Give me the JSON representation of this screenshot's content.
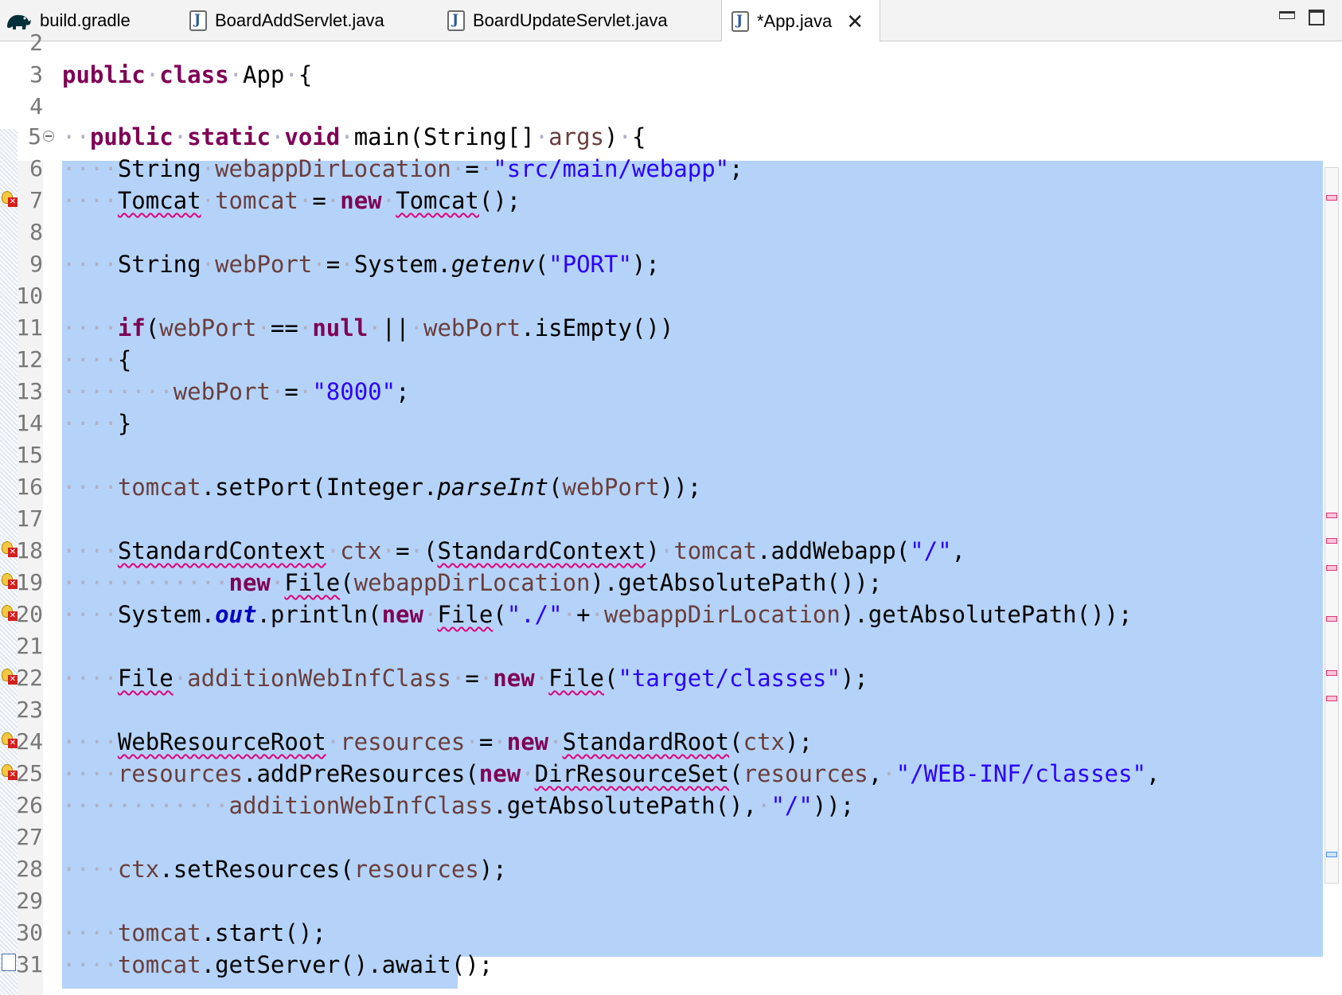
{
  "tabs": [
    {
      "label": "build.gradle",
      "icon": "gradle-elephant-icon",
      "active": false
    },
    {
      "label": "BoardAddServlet.java",
      "icon": "java-file-icon",
      "active": false
    },
    {
      "label": "BoardUpdateServlet.java",
      "icon": "java-file-icon",
      "active": false
    },
    {
      "label": "*App.java",
      "icon": "java-file-icon",
      "active": true
    }
  ],
  "window_controls": {
    "minimize_icon": "minimize-icon",
    "maximize_icon": "maximize-icon"
  },
  "editor": {
    "line_numbers": [
      "2",
      "3",
      "4",
      "5",
      "6",
      "7",
      "8",
      "9",
      "10",
      "11",
      "12",
      "13",
      "14",
      "15",
      "16",
      "17",
      "18",
      "19",
      "20",
      "21",
      "22",
      "23",
      "24",
      "25",
      "26",
      "27",
      "28",
      "29",
      "30",
      "31"
    ],
    "error_marker_lines": [
      "7",
      "18",
      "19",
      "20",
      "22",
      "24",
      "25"
    ],
    "task_marker_lines": [
      "31"
    ],
    "fold_marker_lines": [
      "5"
    ],
    "selection": {
      "from_line": "6",
      "to_line": "31"
    },
    "tokens": {
      "l3": {
        "a": "public",
        "b": "class",
        "c": "App",
        "d": "{"
      },
      "l5": {
        "a": "public",
        "b": "static",
        "c": "void",
        "d": "main(String[]",
        "e": "args",
        "f": ")",
        "g": "{"
      },
      "l6": {
        "a": "String",
        "b": "webappDirLocation",
        "c": "=",
        "d": "\"src/main/webapp\"",
        "e": ";"
      },
      "l7": {
        "a": "Tomcat",
        "b": "tomcat",
        "c": "=",
        "d": "new",
        "e": "Tomcat",
        "f": "();"
      },
      "l9": {
        "a": "String",
        "b": "webPort",
        "c": "=",
        "d": "System.",
        "e": "getenv",
        "f": "(",
        "g": "\"PORT\"",
        "h": ");"
      },
      "l11": {
        "a": "if",
        "b": "(",
        "c": "webPort",
        "d": "==",
        "e": "null",
        "f": "||",
        "g": "webPort",
        "h": ".isEmpty())"
      },
      "l12": {
        "a": "{"
      },
      "l13": {
        "a": "webPort",
        "b": "=",
        "c": "\"8000\"",
        "d": ";"
      },
      "l14": {
        "a": "}"
      },
      "l16": {
        "a": "tomcat",
        "b": ".setPort(Integer.",
        "c": "parseInt",
        "d": "(",
        "e": "webPort",
        "f": "));"
      },
      "l18": {
        "a": "StandardContext",
        "b": "ctx",
        "c": "=",
        "d": "(",
        "e": "StandardContext",
        "f": ")",
        "g": "tomcat",
        "h": ".addWebapp(",
        "i": "\"/\"",
        "j": ","
      },
      "l19": {
        "a": "new",
        "b": "File",
        "c": "(",
        "d": "webappDirLocation",
        "e": ").getAbsolutePath());"
      },
      "l20": {
        "a": "System.",
        "b": "out",
        "c": ".println(",
        "d": "new",
        "e": "File",
        "f": "(",
        "g": "\"./\"",
        "h": "+",
        "i": "webappDirLocation",
        "j": ").getAbsolutePath());"
      },
      "l22": {
        "a": "File",
        "b": "additionWebInfClass",
        "c": "=",
        "d": "new",
        "e": "File",
        "f": "(",
        "g": "\"target/classes\"",
        "h": ");"
      },
      "l24": {
        "a": "WebResourceRoot",
        "b": "resources",
        "c": "=",
        "d": "new",
        "e": "StandardRoot",
        "f": "(",
        "g": "ctx",
        "h": ");"
      },
      "l25": {
        "a": "resources",
        "b": ".addPreResources(",
        "c": "new",
        "d": "DirResourceSet",
        "e": "(",
        "f": "resources",
        "g": ",",
        "h": "\"/WEB-INF/classes\"",
        "i": ","
      },
      "l26": {
        "a": "additionWebInfClass",
        "b": ".getAbsolutePath(),",
        "c": "\"/\"",
        "d": "));"
      },
      "l28": {
        "a": "ctx",
        "b": ".setResources(",
        "c": "resources",
        "d": ");"
      },
      "l30": {
        "a": "tomcat",
        "b": ".start();"
      },
      "l31": {
        "a": "tomcat",
        "b": ".getServer().await();"
      }
    }
  },
  "overview_ruler": {
    "marker_count_errors": "7",
    "marker_count_selection": "1"
  }
}
